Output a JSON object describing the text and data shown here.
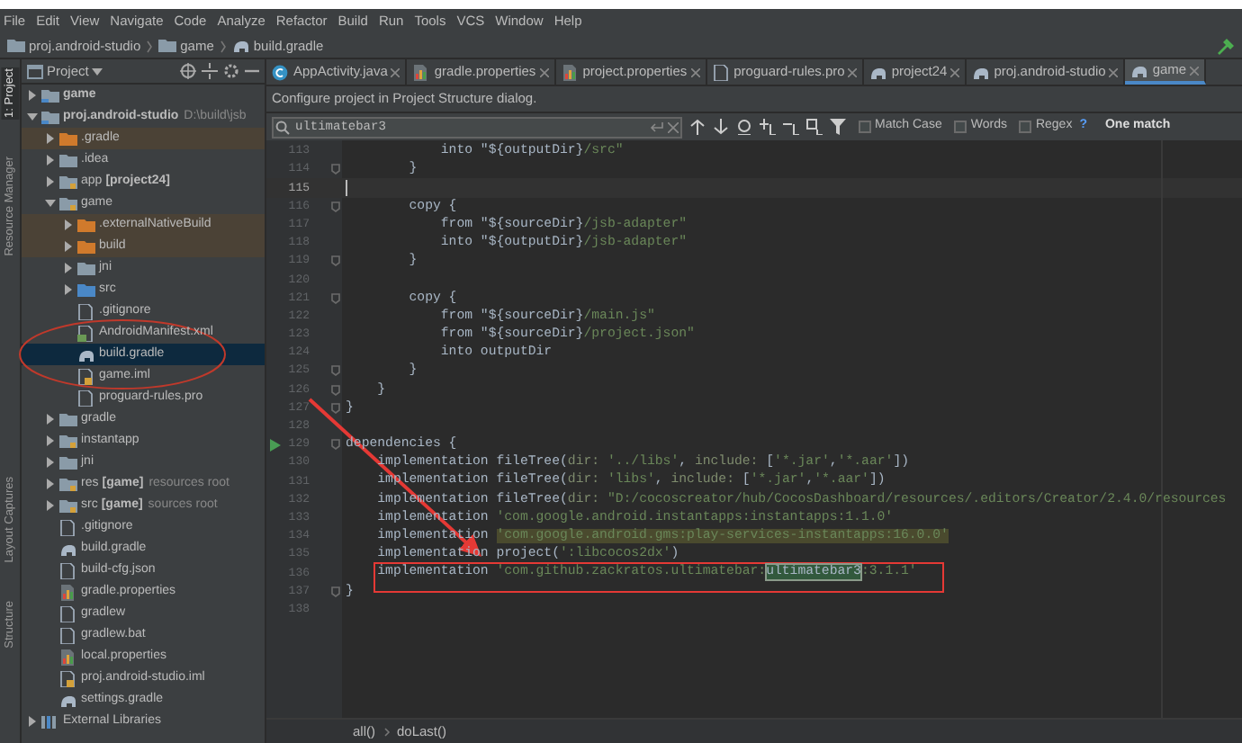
{
  "menu": [
    "File",
    "Edit",
    "View",
    "Navigate",
    "Code",
    "Analyze",
    "Refactor",
    "Build",
    "Run",
    "Tools",
    "VCS",
    "Window",
    "Help"
  ],
  "breadcrumb": [
    "proj.android-studio",
    "game",
    "build.gradle"
  ],
  "tool_strip": [
    {
      "label": "1: Project",
      "selected": true
    },
    {
      "label": "Resource Manager",
      "selected": false
    },
    {
      "label": "Layout Captures",
      "selected": false
    },
    {
      "label": "Structure",
      "selected": false
    }
  ],
  "project_panel": {
    "title": "Project",
    "tree": [
      {
        "label": "game",
        "kind": "module",
        "bold": true,
        "expanded": false
      },
      {
        "label": "proj.android-studio",
        "kind": "module",
        "bold": true,
        "hint": "D:\\build\\jsb",
        "expanded": true,
        "children": [
          {
            "label": ".gradle",
            "kind": "folder-excluded",
            "excluded": true,
            "expanded": false
          },
          {
            "label": ".idea",
            "kind": "folder",
            "expanded": false
          },
          {
            "label": "app",
            "tag": "[project24]",
            "kind": "module-folder",
            "expanded": false
          },
          {
            "label": "game",
            "kind": "module-folder",
            "expanded": true,
            "children": [
              {
                "label": ".externalNativeBuild",
                "kind": "folder-excluded",
                "excluded": true,
                "expanded": false
              },
              {
                "label": "build",
                "kind": "folder-excluded",
                "excluded": true,
                "expanded": false
              },
              {
                "label": "jni",
                "kind": "folder",
                "expanded": false
              },
              {
                "label": "src",
                "kind": "folder-source",
                "expanded": false
              },
              {
                "label": ".gitignore",
                "kind": "file"
              },
              {
                "label": "AndroidManifest.xml",
                "kind": "xml"
              },
              {
                "label": "build.gradle",
                "kind": "gradle",
                "selected": true
              },
              {
                "label": "game.iml",
                "kind": "iml"
              },
              {
                "label": "proguard-rules.pro",
                "kind": "file"
              }
            ]
          },
          {
            "label": "gradle",
            "kind": "folder",
            "expanded": false
          },
          {
            "label": "instantapp",
            "kind": "module-folder",
            "expanded": false
          },
          {
            "label": "jni",
            "kind": "folder",
            "expanded": false
          },
          {
            "label": "res",
            "tag": "[game]",
            "hint": "resources root",
            "kind": "folder-resource",
            "expanded": false
          },
          {
            "label": "src",
            "tag": "[game]",
            "hint": "sources root",
            "kind": "folder-resource",
            "expanded": false
          },
          {
            "label": ".gitignore",
            "kind": "file"
          },
          {
            "label": "build.gradle",
            "kind": "gradle"
          },
          {
            "label": "build-cfg.json",
            "kind": "file"
          },
          {
            "label": "gradle.properties",
            "kind": "properties"
          },
          {
            "label": "gradlew",
            "kind": "file"
          },
          {
            "label": "gradlew.bat",
            "kind": "file"
          },
          {
            "label": "local.properties",
            "kind": "properties"
          },
          {
            "label": "proj.android-studio.iml",
            "kind": "iml"
          },
          {
            "label": "settings.gradle",
            "kind": "gradle"
          }
        ]
      },
      {
        "label": "External Libraries",
        "kind": "library",
        "expanded": false
      }
    ]
  },
  "tabs": [
    {
      "label": "AppActivity.java",
      "kind": "java",
      "selected": false
    },
    {
      "label": "gradle.properties",
      "kind": "properties",
      "selected": false
    },
    {
      "label": "project.properties",
      "kind": "properties",
      "selected": false
    },
    {
      "label": "proguard-rules.pro",
      "kind": "file",
      "selected": false
    },
    {
      "label": "project24",
      "kind": "gradle",
      "selected": false
    },
    {
      "label": "proj.android-studio",
      "kind": "gradle",
      "selected": false
    },
    {
      "label": "game",
      "kind": "gradle",
      "selected": true
    }
  ],
  "banner": "Configure project in Project Structure dialog.",
  "search": {
    "value": "ultimatebar3",
    "options": [
      {
        "label": "Match Case",
        "checked": false
      },
      {
        "label": "Words",
        "checked": false
      },
      {
        "label": "Regex",
        "checked": false
      }
    ],
    "help": "?",
    "result": "One match"
  },
  "code": [
    {
      "n": "113",
      "segments": [
        {
          "kind": "plain",
          "text": "            into \"${outputDir}"
        },
        {
          "kind": "string",
          "text": "/src\""
        }
      ]
    },
    {
      "n": "114",
      "fold": true,
      "segments": [
        {
          "kind": "plain",
          "text": "        }"
        }
      ]
    },
    {
      "n": "115",
      "current": true
    },
    {
      "n": "116",
      "fold": true,
      "segments": [
        {
          "kind": "plain",
          "text": "        copy {"
        }
      ]
    },
    {
      "n": "117",
      "segments": [
        {
          "kind": "plain",
          "text": "            from \"${sourceDir}"
        },
        {
          "kind": "string",
          "text": "/jsb-adapter\""
        }
      ]
    },
    {
      "n": "118",
      "segments": [
        {
          "kind": "plain",
          "text": "            into \"${outputDir}"
        },
        {
          "kind": "string",
          "text": "/jsb-adapter\""
        }
      ]
    },
    {
      "n": "119",
      "fold": true,
      "segments": [
        {
          "kind": "plain",
          "text": "        }"
        }
      ]
    },
    {
      "n": "120"
    },
    {
      "n": "121",
      "fold": true,
      "segments": [
        {
          "kind": "plain",
          "text": "        copy {"
        }
      ]
    },
    {
      "n": "122",
      "segments": [
        {
          "kind": "plain",
          "text": "            from \"${sourceDir}"
        },
        {
          "kind": "string",
          "text": "/main.js\""
        }
      ]
    },
    {
      "n": "123",
      "segments": [
        {
          "kind": "plain",
          "text": "            from \"${sourceDir}"
        },
        {
          "kind": "string",
          "text": "/project.json\""
        }
      ]
    },
    {
      "n": "124",
      "segments": [
        {
          "kind": "plain",
          "text": "            into outputDir"
        }
      ]
    },
    {
      "n": "125",
      "fold": true,
      "segments": [
        {
          "kind": "plain",
          "text": "        }"
        }
      ]
    },
    {
      "n": "126",
      "fold": true,
      "segments": [
        {
          "kind": "plain",
          "text": "    }"
        }
      ]
    },
    {
      "n": "127",
      "fold": true,
      "segments": [
        {
          "kind": "plain",
          "text": "}"
        }
      ]
    },
    {
      "n": "128"
    },
    {
      "n": "129",
      "fold": true,
      "run": true,
      "segments": [
        {
          "kind": "plain",
          "text": "dependencies {"
        }
      ]
    },
    {
      "n": "130",
      "segments": [
        {
          "kind": "plain",
          "text": "    implementation fileTree("
        },
        {
          "kind": "param",
          "text": "dir: "
        },
        {
          "kind": "string",
          "text": "'../libs'"
        },
        {
          "kind": "plain",
          "text": ", "
        },
        {
          "kind": "param",
          "text": "include: "
        },
        {
          "kind": "plain",
          "text": "["
        },
        {
          "kind": "string",
          "text": "'*.jar'"
        },
        {
          "kind": "plain",
          "text": ","
        },
        {
          "kind": "string",
          "text": "'*.aar'"
        },
        {
          "kind": "plain",
          "text": "])"
        }
      ]
    },
    {
      "n": "131",
      "segments": [
        {
          "kind": "plain",
          "text": "    implementation fileTree("
        },
        {
          "kind": "param",
          "text": "dir: "
        },
        {
          "kind": "string",
          "text": "'libs'"
        },
        {
          "kind": "plain",
          "text": ", "
        },
        {
          "kind": "param",
          "text": "include: "
        },
        {
          "kind": "plain",
          "text": "["
        },
        {
          "kind": "string",
          "text": "'*.jar'"
        },
        {
          "kind": "plain",
          "text": ","
        },
        {
          "kind": "string",
          "text": "'*.aar'"
        },
        {
          "kind": "plain",
          "text": "])"
        }
      ]
    },
    {
      "n": "132",
      "segments": [
        {
          "kind": "plain",
          "text": "    implementation fileTree("
        },
        {
          "kind": "param",
          "text": "dir: "
        },
        {
          "kind": "string",
          "text": "\"D:/cocoscreator/hub/CocosDashboard/resources/.editors/Creator/2.4.0/resources"
        }
      ]
    },
    {
      "n": "133",
      "segments": [
        {
          "kind": "plain",
          "text": "    implementation "
        },
        {
          "kind": "string",
          "text": "'com.google.android.instantapps:instantapps:1.1.0'"
        }
      ]
    },
    {
      "n": "134",
      "segments": [
        {
          "kind": "plain",
          "text": "    implementation "
        },
        {
          "kind": "warning",
          "text": "'com.google.android.gms:play-services-instantapps:16.0.0'"
        }
      ]
    },
    {
      "n": "135",
      "segments": [
        {
          "kind": "plain",
          "text": "    implementation project("
        },
        {
          "kind": "string",
          "text": "':libcocos2dx'"
        },
        {
          "kind": "plain",
          "text": ")"
        }
      ]
    },
    {
      "n": "136",
      "segments": [
        {
          "kind": "plain",
          "text": "    implementation "
        },
        {
          "kind": "string",
          "text": "'com.github.zackratos.ultimatebar:"
        },
        {
          "kind": "match",
          "text": "ultimatebar3"
        },
        {
          "kind": "string",
          "text": ":3.1.1'"
        }
      ]
    },
    {
      "n": "137",
      "fold": true,
      "segments": [
        {
          "kind": "plain",
          "text": "}"
        }
      ]
    },
    {
      "n": "138"
    }
  ],
  "editor_breadcrumb": [
    "all()",
    "doLast()"
  ]
}
